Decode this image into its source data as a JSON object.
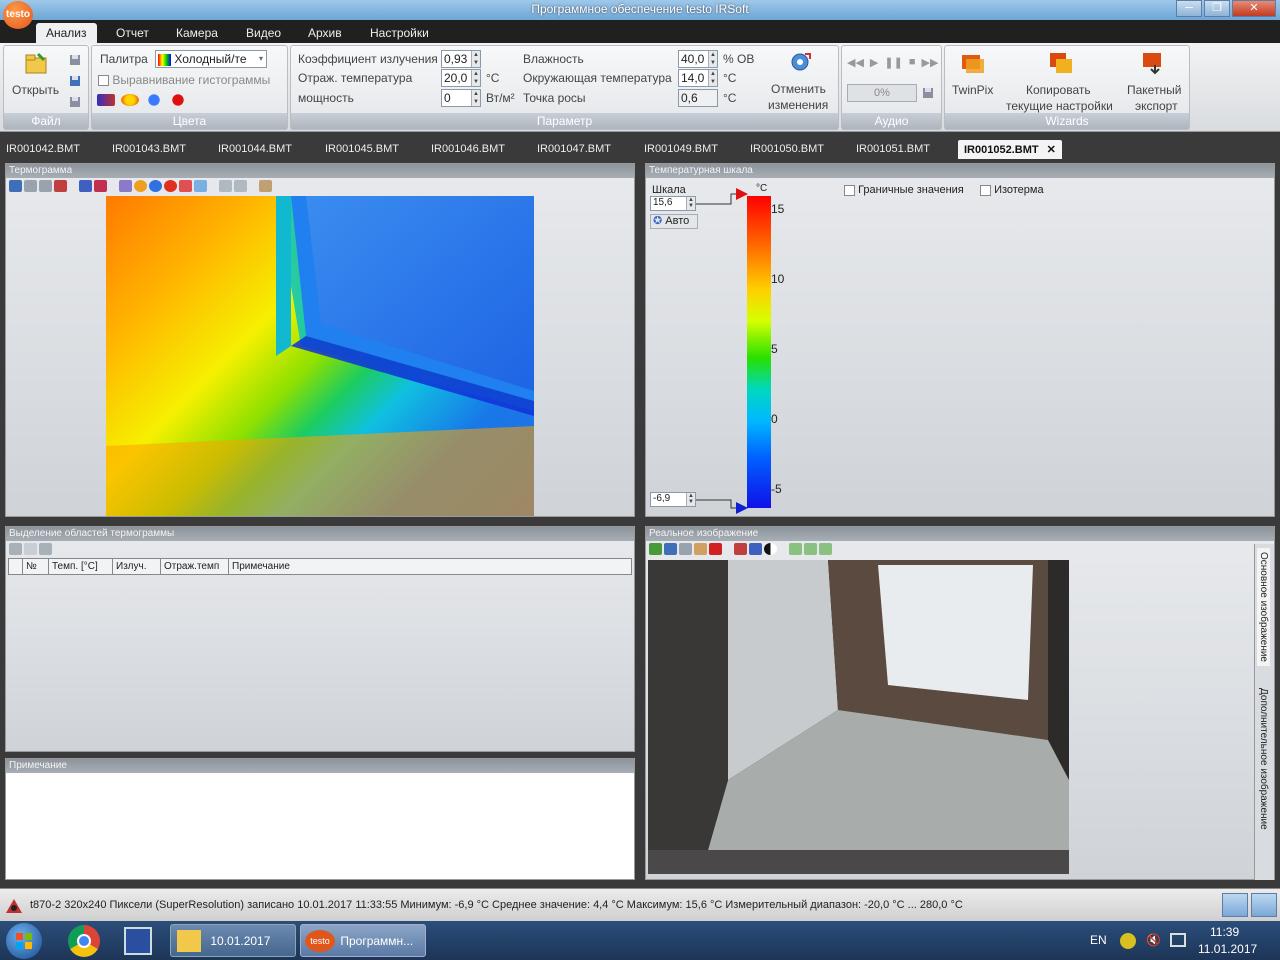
{
  "window": {
    "title": "Программное обеспечение testo IRSoft",
    "logo": "testo",
    "controls": [
      "─",
      "❐",
      "✕"
    ]
  },
  "ribbon_tabs": [
    "Анализ",
    "Отчет",
    "Камера",
    "Видео",
    "Архив",
    "Настройки"
  ],
  "file_group": {
    "open_label": "Открыть",
    "label": "Файл"
  },
  "colors_group": {
    "palette_label": "Палитра",
    "palette_value": "Холодный/те",
    "hist_label": "Выравнивание гистограммы",
    "label": "Цвета"
  },
  "param_group": {
    "emissivity_label": "Коэффициент излучения",
    "emissivity_value": "0,93",
    "refl_temp_label": "Отраж. температура",
    "refl_temp_value": "20,0",
    "refl_temp_unit": "°C",
    "power_label": "мощность",
    "power_value": "0",
    "power_unit": "Вт/м²",
    "humidity_label": "Влажность",
    "humidity_value": "40,0",
    "humidity_unit": "% ОВ",
    "ambient_label": "Окружающая температура",
    "ambient_value": "14,0",
    "ambient_unit": "°C",
    "dew_label": "Точка росы",
    "dew_value": "0,6",
    "dew_unit": "°C",
    "undo_label_1": "Отменить",
    "undo_label_2": "изменения",
    "label": "Параметр"
  },
  "audio_group": {
    "progress": "0%",
    "label": "Аудио"
  },
  "wizards_group": {
    "twinpix": "TwinPix",
    "copy_1": "Копировать",
    "copy_2": "текущие настройки",
    "batch_1": "Пакетный",
    "batch_2": "экспорт",
    "label": "Wizards"
  },
  "file_tabs": [
    "IR001042.BMT",
    "IR001043.BMT",
    "IR001044.BMT",
    "IR001045.BMT",
    "IR001046.BMT",
    "IR001047.BMT",
    "IR001049.BMT",
    "IR001050.BMT",
    "IR001051.BMT",
    "IR001052.BMT"
  ],
  "file_tab_close": "✕",
  "thermogram": {
    "title": "Термограмма"
  },
  "temp_scale": {
    "title": "Температурная шкала",
    "scale_label": "Шкала",
    "max_value": "15,6",
    "min_value": "-6,9",
    "auto_label": "Авто",
    "unit": "°C",
    "ticks": [
      "15",
      "10",
      "5",
      "0",
      "-5"
    ],
    "limits_label": "Граничные значения",
    "isotherm_label": "Изотерма"
  },
  "regions": {
    "title": "Выделение областей термограммы",
    "columns": [
      "№",
      "Темп. [°C]",
      "Излуч.",
      "Отраж.темп",
      "Примечание"
    ]
  },
  "note": {
    "title": "Примечание"
  },
  "real_image": {
    "title": "Реальное изображение",
    "side_tab_1": "Основное изображение",
    "side_tab_2": "Дополнительное изображение"
  },
  "status": {
    "text": "t870-2  320x240  Пиксели  (SuperResolution)  записано  10.01.2017  11:33:55  Минимум:  -6,9 °C  Среднее значение:  4,4 °C  Максимум:  15,6 °C  Измерительный диапазон:  -20,0 °C ... 280,0 °C"
  },
  "taskbar": {
    "folder": "10.01.2017",
    "app": "Программн...",
    "app_logo": "testo",
    "lang": "EN",
    "time": "11:39",
    "date": "11.01.2017"
  }
}
